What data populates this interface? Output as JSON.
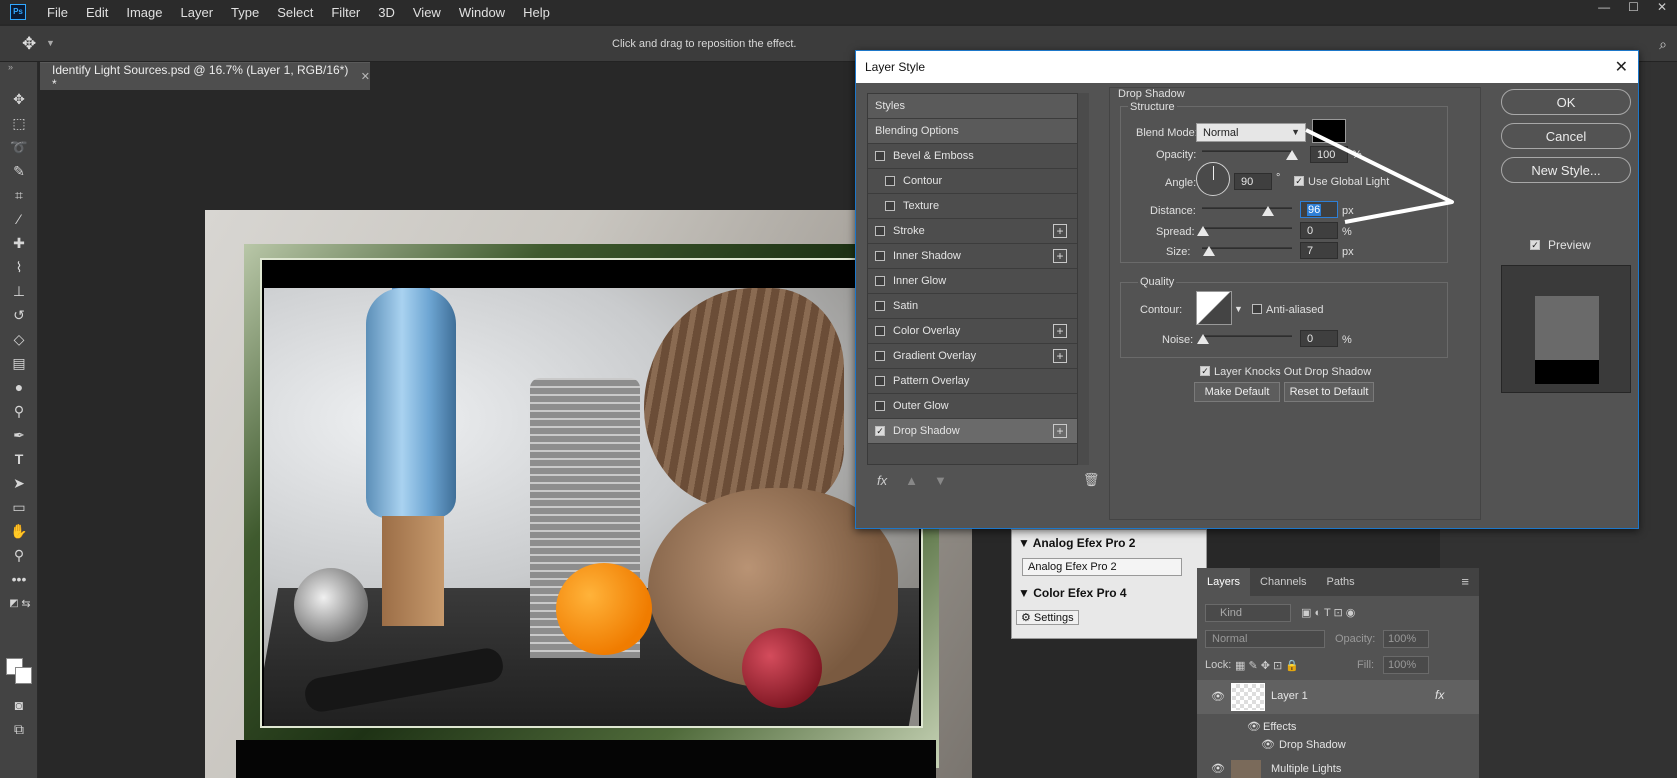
{
  "app": {
    "logo_text": "Ps",
    "menu": [
      "File",
      "Edit",
      "Image",
      "Layer",
      "Type",
      "Select",
      "Filter",
      "3D",
      "View",
      "Window",
      "Help"
    ],
    "window_controls": [
      "—",
      "☐",
      "✕"
    ]
  },
  "options_bar": {
    "hint": "Click and drag to reposition the effect."
  },
  "document": {
    "tab_title": "Identify Light Sources.psd @ 16.7% (Layer 1, RGB/16*) *",
    "close_glyph": "✕"
  },
  "dialog": {
    "title": "Layer Style",
    "close_glyph": "✕",
    "styles_list": [
      {
        "label": "Styles",
        "type": "head"
      },
      {
        "label": "Blending Options",
        "type": "head"
      },
      {
        "label": "Bevel & Emboss",
        "checked": false,
        "plus": false,
        "indent": 0
      },
      {
        "label": "Contour",
        "checked": false,
        "plus": false,
        "indent": 1
      },
      {
        "label": "Texture",
        "checked": false,
        "plus": false,
        "indent": 1
      },
      {
        "label": "Stroke",
        "checked": false,
        "plus": true,
        "indent": 0
      },
      {
        "label": "Inner Shadow",
        "checked": false,
        "plus": true,
        "indent": 0
      },
      {
        "label": "Inner Glow",
        "checked": false,
        "plus": false,
        "indent": 0
      },
      {
        "label": "Satin",
        "checked": false,
        "plus": false,
        "indent": 0
      },
      {
        "label": "Color Overlay",
        "checked": false,
        "plus": true,
        "indent": 0
      },
      {
        "label": "Gradient Overlay",
        "checked": false,
        "plus": true,
        "indent": 0
      },
      {
        "label": "Pattern Overlay",
        "checked": false,
        "plus": false,
        "indent": 0
      },
      {
        "label": "Outer Glow",
        "checked": false,
        "plus": false,
        "indent": 0
      },
      {
        "label": "Drop Shadow",
        "checked": true,
        "plus": true,
        "indent": 0,
        "selected": true
      }
    ],
    "fx_label": "fx",
    "drop_shadow": {
      "section_title": "Drop Shadow",
      "structure_title": "Structure",
      "blend_mode_label": "Blend Mode:",
      "blend_mode_value": "Normal",
      "shadow_color": "#000000",
      "opacity_label": "Opacity:",
      "opacity_value": "100",
      "opacity_unit": "%",
      "angle_label": "Angle:",
      "angle_value": "90",
      "angle_unit": "°",
      "use_global_light_label": "Use Global Light",
      "use_global_light": true,
      "distance_label": "Distance:",
      "distance_value": "96",
      "distance_unit": "px",
      "spread_label": "Spread:",
      "spread_value": "0",
      "spread_unit": "%",
      "size_label": "Size:",
      "size_value": "7",
      "size_unit": "px",
      "quality_title": "Quality",
      "contour_label": "Contour:",
      "anti_aliased_label": "Anti-aliased",
      "anti_aliased": false,
      "noise_label": "Noise:",
      "noise_value": "0",
      "noise_unit": "%",
      "knocks_out_label": "Layer Knocks Out Drop Shadow",
      "knocks_out": true,
      "make_default_label": "Make Default",
      "reset_default_label": "Reset to Default"
    },
    "buttons": {
      "ok": "OK",
      "cancel": "Cancel",
      "new_style": "New Style..."
    },
    "preview_label": "Preview",
    "preview_checked": true
  },
  "analog_panel": {
    "header1": "Analog Efex Pro 2",
    "button": "Analog Efex Pro 2",
    "header2": "Color Efex Pro 4",
    "settings_tab": "Settings"
  },
  "layers_panel": {
    "tabs": [
      "Layers",
      "Channels",
      "Paths"
    ],
    "kind_label": "Kind",
    "blend_value": "Normal",
    "opacity_label": "Opacity:",
    "opacity_value": "100%",
    "lock_label": "Lock:",
    "fill_label": "Fill:",
    "fill_value": "100%",
    "layers": [
      {
        "name": "Layer 1",
        "fx": "fx"
      },
      {
        "name": "Effects"
      },
      {
        "name": "Drop Shadow"
      },
      {
        "name": "Multiple Lights"
      }
    ]
  }
}
